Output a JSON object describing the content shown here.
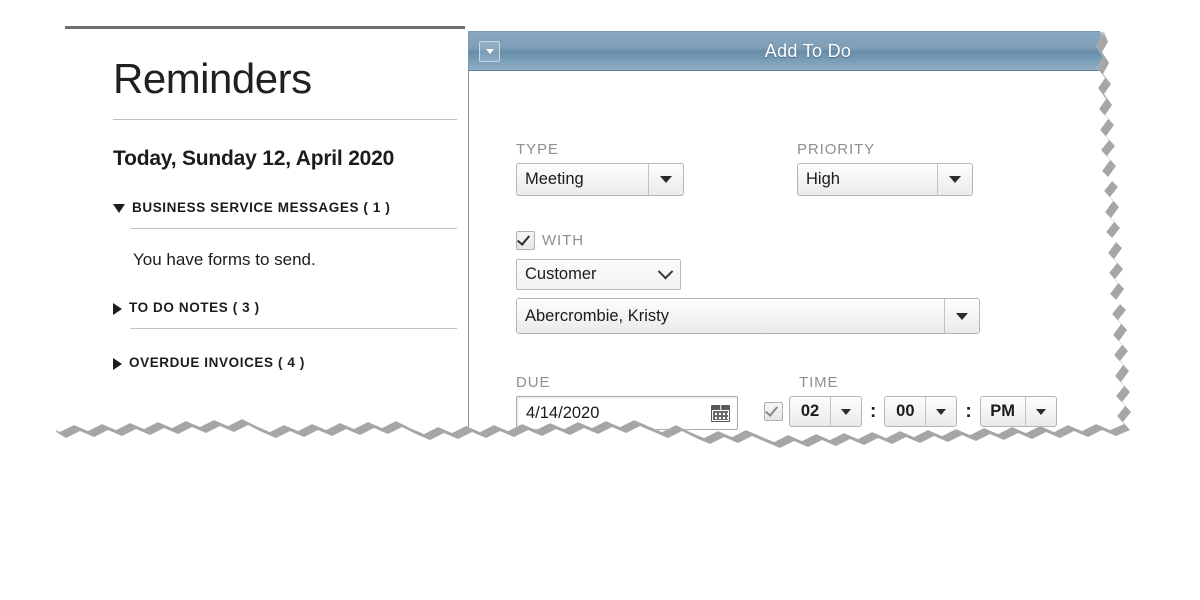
{
  "reminders": {
    "title": "Reminders",
    "today": "Today, Sunday 12, April 2020",
    "sections": [
      {
        "icon": "triangle-down-icon",
        "label": "BUSINESS SERVICE MESSAGES ( 1 )",
        "expanded": true,
        "count": "1"
      },
      {
        "icon": "triangle-right-icon",
        "label": "TO DO NOTES ( 3 )",
        "expanded": false,
        "count": "3"
      },
      {
        "icon": "triangle-right-icon",
        "label": "OVERDUE INVOICES ( 4 )",
        "expanded": false,
        "count": "4"
      }
    ],
    "business_message": "You have forms to send."
  },
  "dialog": {
    "title": "Add To Do",
    "system_icon": "window-menu-icon",
    "fields": {
      "type": {
        "label": "TYPE",
        "value": "Meeting",
        "arrow": "chevron-down-icon"
      },
      "priority": {
        "label": "PRIORITY",
        "value": "High",
        "arrow": "chevron-down-icon"
      },
      "with": {
        "label": "WITH",
        "checked": true
      },
      "with_kind": {
        "value": "Customer",
        "arrow": "chevron-down-icon"
      },
      "with_name": {
        "value": "Abercrombie, Kristy",
        "arrow": "chevron-down-icon"
      },
      "due": {
        "label": "DUE",
        "value": "4/14/2020",
        "icon": "calendar-icon"
      },
      "time": {
        "label": "TIME",
        "checked": true,
        "hour": "02",
        "minute": "00",
        "meridiem": "PM",
        "separator": ":"
      }
    }
  },
  "colors": {
    "titlebar": "#7e9db6",
    "titlebar_text": "#ffffff",
    "field_label": "#8f8f8f",
    "text": "#1b1b1b",
    "page_bg": "#ffffff"
  }
}
